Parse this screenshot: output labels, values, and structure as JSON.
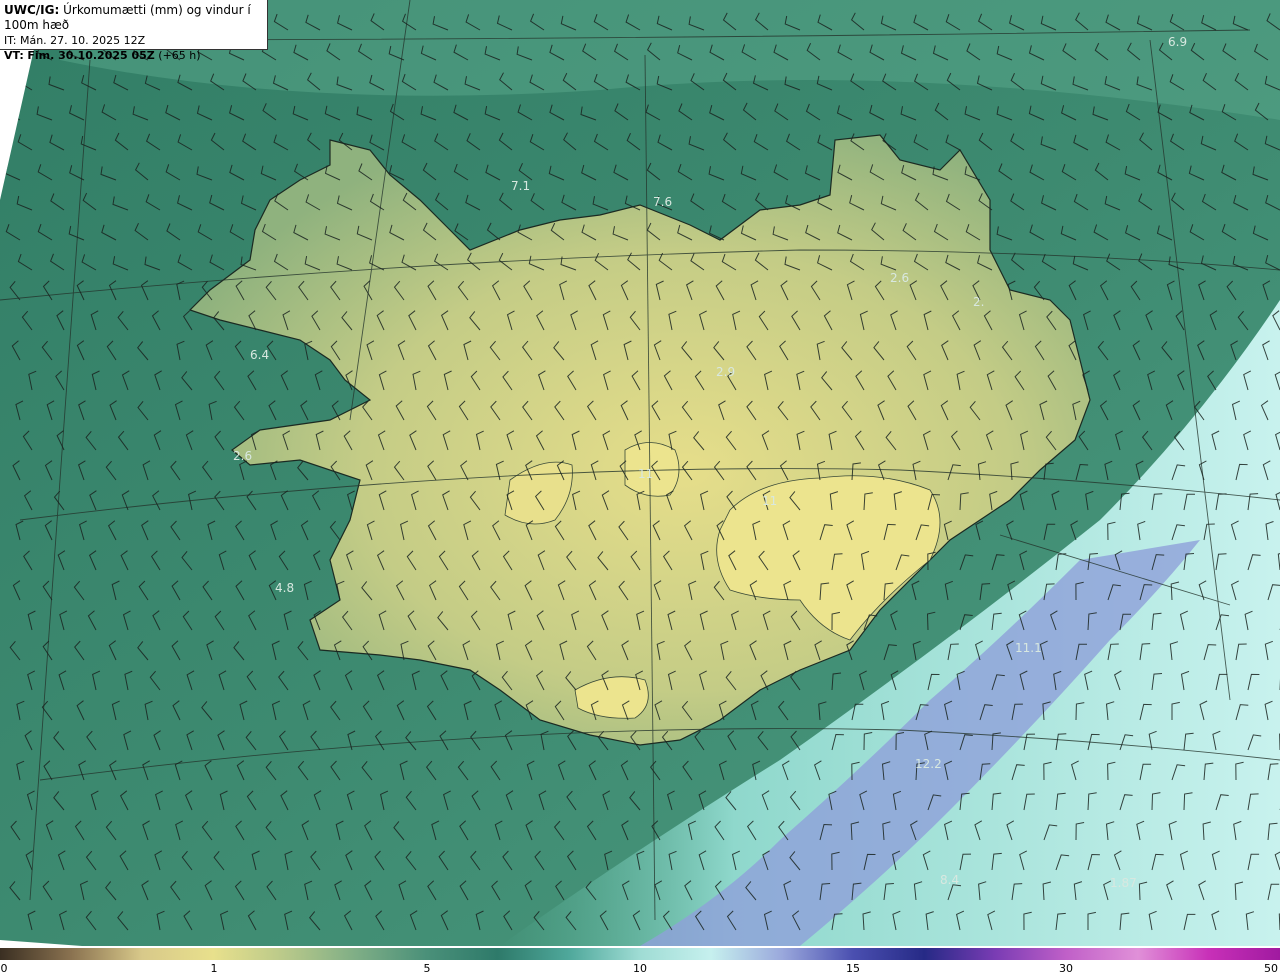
{
  "header": {
    "model": "UWC/IG:",
    "title": "Úrkomumætti (mm) og vindur í 100m hæð",
    "init_label": "IT:",
    "init_time": "Mán. 27. 10. 2025 12Z",
    "valid_label": "VT:",
    "valid_time": "Fim. 30.10.2025 05Z",
    "lead": "(+65 h)"
  },
  "map_labels": [
    "6.9",
    "7.1",
    "7.6",
    "2.6",
    "2.",
    "6.4",
    "2.9",
    "2.6",
    "11",
    "11",
    "4.8",
    "11.1",
    "12.2",
    "8.4",
    "1.87"
  ],
  "colorbar": {
    "ticks": [
      "0",
      "1",
      "5",
      "10",
      "15",
      "30",
      "50"
    ],
    "colors": [
      "#3a2f22",
      "#8a7250",
      "#d8c98a",
      "#e8e08c",
      "#b9c98a",
      "#7fae86",
      "#4a9079",
      "#2e7a6a",
      "#4fa89b",
      "#9fdcd4",
      "#c6f0ee",
      "#9aa8dc",
      "#4a4fb0",
      "#262a86",
      "#7a3cb4",
      "#c060c8",
      "#e090d8",
      "#c830b8",
      "#a01aa0"
    ]
  },
  "colors": {
    "sea_dark": "#2f7a62",
    "sea_mid": "#4a9a7c",
    "land": "#b8c683",
    "land_light": "#e2dc86",
    "wet": "#b7e9e3",
    "heavy": "#7d8fd0"
  }
}
